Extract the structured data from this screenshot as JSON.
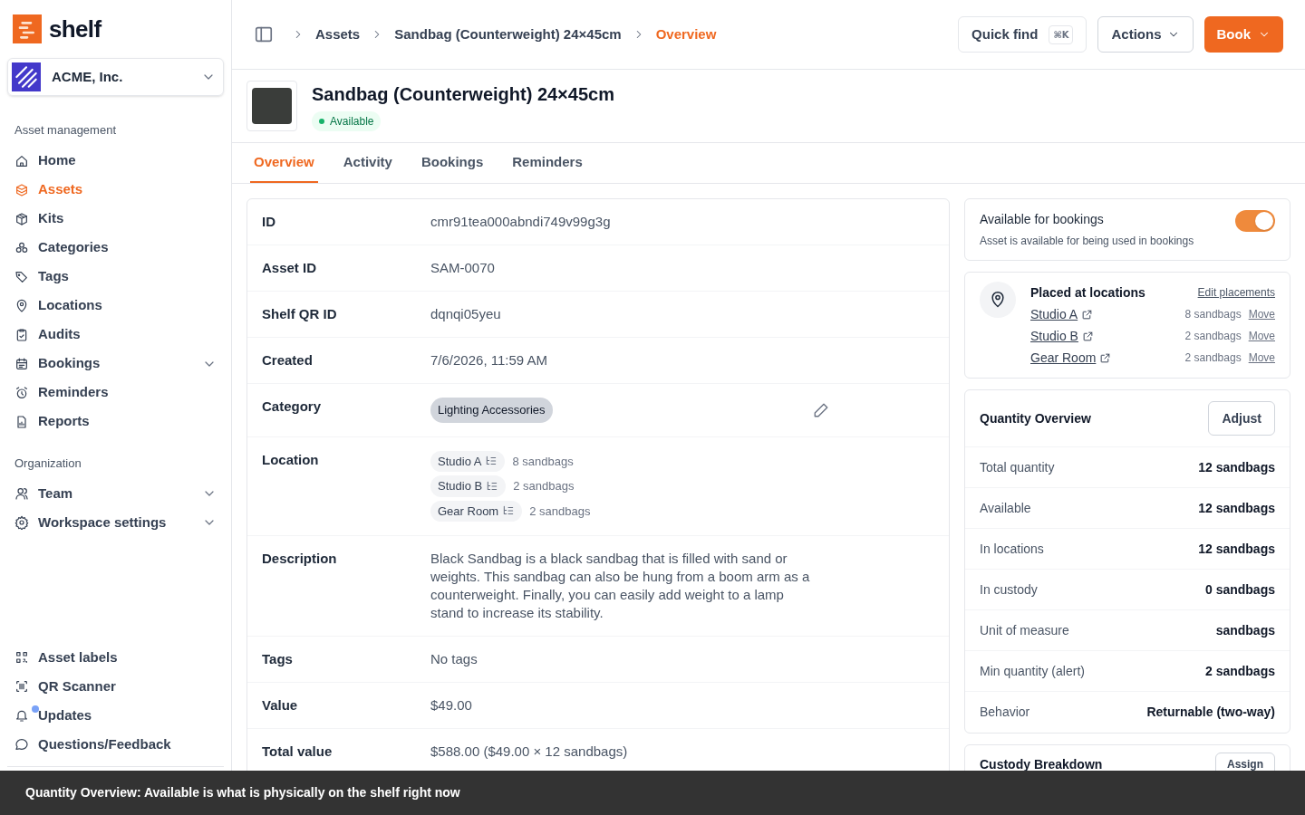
{
  "logo": {
    "text": "shelf"
  },
  "workspace": {
    "name": "ACME, Inc."
  },
  "sidebar": {
    "sections": [
      {
        "heading": "Asset management",
        "items": [
          {
            "label": "Home",
            "selected": false
          },
          {
            "label": "Assets",
            "selected": true
          },
          {
            "label": "Kits",
            "selected": false
          },
          {
            "label": "Categories",
            "selected": false
          },
          {
            "label": "Tags",
            "selected": false
          },
          {
            "label": "Locations",
            "selected": false
          },
          {
            "label": "Audits",
            "selected": false
          },
          {
            "label": "Bookings",
            "selected": false,
            "expandable": true
          },
          {
            "label": "Reminders",
            "selected": false
          },
          {
            "label": "Reports",
            "selected": false
          }
        ]
      },
      {
        "heading": "Organization",
        "items": [
          {
            "label": "Team",
            "selected": false,
            "expandable": true
          },
          {
            "label": "Workspace settings",
            "selected": false,
            "expandable": true
          }
        ]
      }
    ],
    "bottom_items": [
      {
        "label": "Asset labels"
      },
      {
        "label": "QR Scanner"
      },
      {
        "label": "Updates",
        "unread": true
      },
      {
        "label": "Questions/Feedback"
      }
    ]
  },
  "breadcrumbs": [
    {
      "label": "Assets",
      "current": false
    },
    {
      "label": "Sandbag (Counterweight) 24×45cm",
      "current": false
    },
    {
      "label": "Overview",
      "current": true
    }
  ],
  "header_buttons": {
    "quick_find": {
      "label": "Quick find",
      "shortcut": "⌘K"
    },
    "actions": "Actions",
    "book": "Book"
  },
  "asset": {
    "title": "Sandbag (Counterweight) 24×45cm",
    "status": "Available"
  },
  "tabs": [
    {
      "label": "Overview",
      "selected": true
    },
    {
      "label": "Activity",
      "selected": false
    },
    {
      "label": "Bookings",
      "selected": false
    },
    {
      "label": "Reminders",
      "selected": false
    }
  ],
  "details": [
    {
      "kind": "text",
      "label": "ID",
      "value": "cmr91tea000abndi749v99g3g"
    },
    {
      "kind": "text",
      "label": "Asset ID",
      "value": "SAM-0070"
    },
    {
      "kind": "text",
      "label": "Shelf QR ID",
      "value": "dqnqi05yeu"
    },
    {
      "kind": "text",
      "label": "Created",
      "value": "7/6/2026, 11:59 AM"
    },
    {
      "kind": "chip",
      "label": "Category",
      "value": "Lighting Accessories"
    },
    {
      "kind": "locations",
      "label": "Location",
      "locations": [
        {
          "name": "Studio A",
          "count": "8 sandbags"
        },
        {
          "name": "Studio B",
          "count": "2 sandbags"
        },
        {
          "name": "Gear Room",
          "count": "2 sandbags"
        }
      ]
    },
    {
      "kind": "text",
      "label": "Description",
      "value": "Black Sandbag is a black sandbag that is filled with sand or weights. This sandbag can also be hung from a boom arm as a counterweight. Finally, you can easily add weight to a lamp stand to increase its stability."
    },
    {
      "kind": "text",
      "label": "Tags",
      "value": "No tags"
    },
    {
      "kind": "text",
      "label": "Value",
      "value": "$49.00"
    },
    {
      "kind": "text",
      "label": "Total value",
      "value": "$588.00 ($49.00 × 12 sandbags)"
    }
  ],
  "booking_toggle": {
    "title": "Available for bookings",
    "description": "Asset is available for being used in bookings",
    "on": true
  },
  "placements": {
    "title": "Placed at locations",
    "edit_link": "Edit placements",
    "locations": [
      {
        "name": "Studio A",
        "count": "8 sandbags",
        "action": "Move"
      },
      {
        "name": "Studio B",
        "count": "2 sandbags",
        "action": "Move"
      },
      {
        "name": "Gear Room",
        "count": "2 sandbags",
        "action": "Move"
      }
    ]
  },
  "quantity_overview": {
    "title": "Quantity Overview",
    "button": "Adjust",
    "rows": [
      {
        "label": "Total quantity",
        "value": "12 sandbags"
      },
      {
        "label": "Available",
        "value": "12 sandbags"
      },
      {
        "label": "In locations",
        "value": "12 sandbags"
      },
      {
        "label": "In custody",
        "value": "0 sandbags"
      },
      {
        "label": "Unit of measure",
        "value": "sandbags"
      },
      {
        "label": "Min quantity (alert)",
        "value": "2 sandbags"
      },
      {
        "label": "Behavior",
        "value": "Returnable (two-way)"
      }
    ]
  },
  "custody_breakdown": {
    "title": "Custody Breakdown",
    "button": "Assign"
  },
  "caption": "Quantity Overview: Available is what is physically on the shelf right now"
}
